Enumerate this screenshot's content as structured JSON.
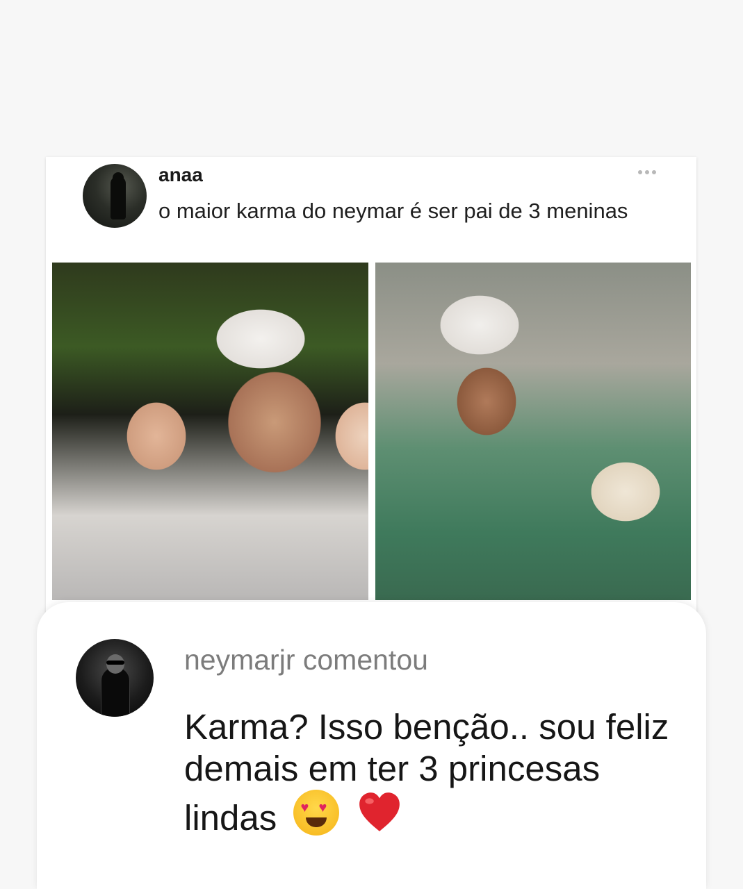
{
  "post": {
    "author": "anaa",
    "text": "o maior karma do neymar é ser pai de 3 meninas"
  },
  "comment": {
    "header": "neymarjr comentou",
    "text": "Karma? Isso benção.. sou feliz demais em ter 3 princesas lindas",
    "emojis": [
      "heart-eyes-emoji",
      "red-heart-emoji"
    ]
  },
  "icons": {
    "more": "more-horizontal-icon"
  },
  "colors": {
    "background": "#f7f7f7",
    "card": "#ffffff",
    "comment_header": "#7c7c7c",
    "text": "#161616",
    "heart": "#e0242e"
  }
}
